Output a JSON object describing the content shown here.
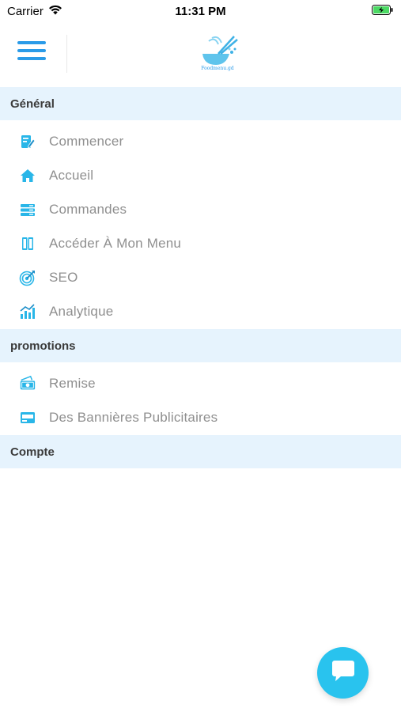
{
  "colors": {
    "accent": "#2a9be8",
    "icon": "#29b6e8",
    "section_bg": "#e6f3fd",
    "fab": "#29c3ee",
    "label": "#8f8f8f",
    "battery": "#4cd964"
  },
  "status_bar": {
    "carrier": "Carrier",
    "time": "11:31 PM",
    "icons": [
      "wifi-icon",
      "battery-charging-icon"
    ]
  },
  "nav": {
    "menu_icon": "hamburger-icon",
    "logo_icon": "noodle-bowl-logo",
    "logo_text": "Foodmenu.gd"
  },
  "sections": [
    {
      "title": "Général",
      "items": [
        {
          "label": "Commencer",
          "icon": "edit-document-icon"
        },
        {
          "label": "Accueil",
          "icon": "home-icon"
        },
        {
          "label": "Commandes",
          "icon": "orders-list-icon"
        },
        {
          "label": "Accéder À Mon Menu",
          "icon": "menu-book-icon"
        },
        {
          "label": "SEO",
          "icon": "target-icon"
        },
        {
          "label": "Analytique",
          "icon": "analytics-chart-icon"
        }
      ]
    },
    {
      "title": "promotions",
      "items": [
        {
          "label": "Remise",
          "icon": "discount-cash-icon"
        },
        {
          "label": "Des Bannières Publicitaires",
          "icon": "banner-ad-icon"
        }
      ]
    },
    {
      "title": "Compte",
      "items": []
    }
  ],
  "fab": {
    "icon": "chat-bubble-icon"
  }
}
